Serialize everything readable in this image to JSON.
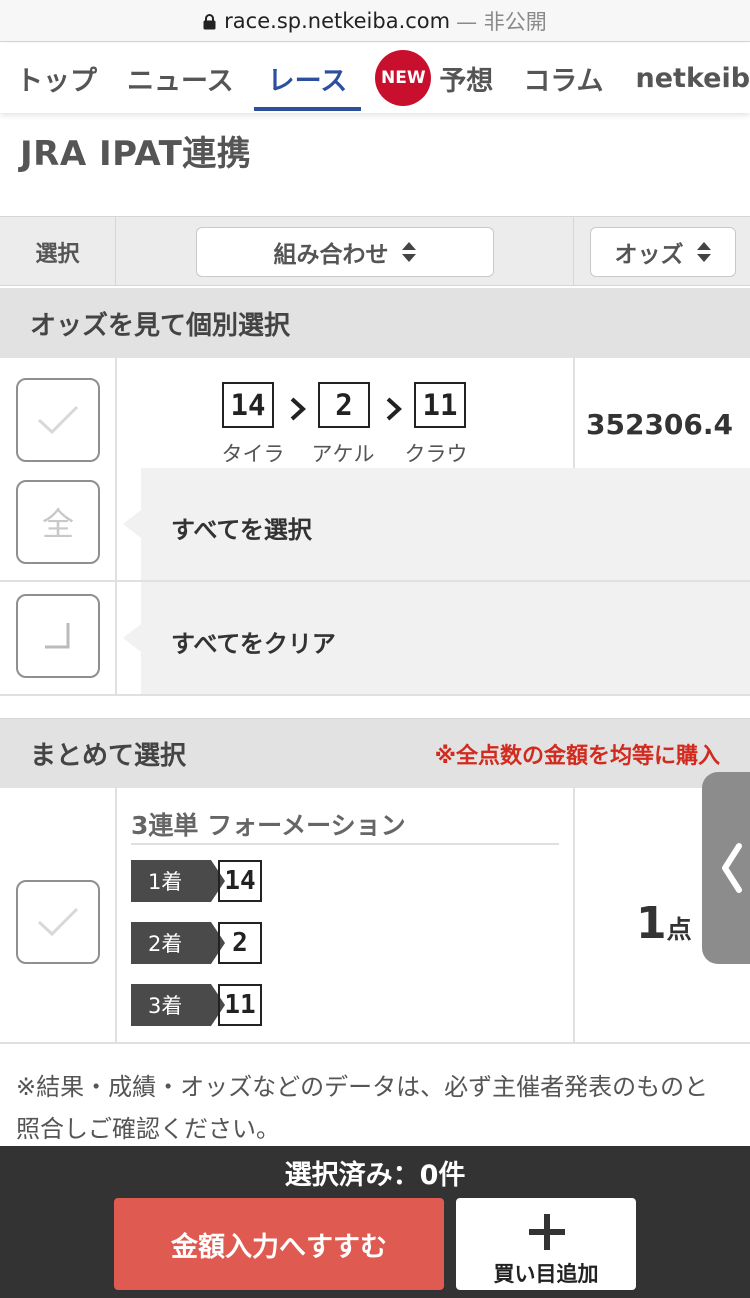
{
  "browser": {
    "url": "race.sp.netkeiba.com",
    "privacy_label": "— 非公開"
  },
  "nav": {
    "items": [
      {
        "label": "トップ"
      },
      {
        "label": "ニュース"
      },
      {
        "label": "レース",
        "active": true
      },
      {
        "label": "予想",
        "badge": "NEW"
      },
      {
        "label": "コラム"
      },
      {
        "label": "netkeiba"
      }
    ]
  },
  "page": {
    "title": "JRA IPAT連携"
  },
  "table_header": {
    "select": "選択",
    "combination": "組み合わせ",
    "odds": "オッズ"
  },
  "individual": {
    "heading": "オッズを見て個別選択",
    "bet": {
      "numbers": [
        "14",
        "2",
        "11"
      ],
      "horses": [
        "タイラ",
        "アケル",
        "クラウ"
      ],
      "odds": "352306.4"
    },
    "select_all": {
      "icon_char": "全",
      "label": "すべてを選択"
    },
    "clear_all": {
      "label": "すべてをクリア"
    }
  },
  "bulk": {
    "heading": "まとめて選択",
    "note": "※全点数の金額を均等に購入",
    "bet_type": "3連単 フォーメーション",
    "places": [
      {
        "tag": "1着",
        "number": "14"
      },
      {
        "tag": "2着",
        "number": "2"
      },
      {
        "tag": "3着",
        "number": "11"
      }
    ],
    "points": "1",
    "points_unit": "点"
  },
  "footnote": "※結果・成績・オッズなどのデータは、必ず主催者発表のものと照合しご確認ください。",
  "bottom": {
    "selected": "選択済み：0件",
    "proceed": "金額入力へすすむ",
    "add": "買い目追加"
  },
  "colors": {
    "accent_blue": "#2c4f9e",
    "badge_red": "#c8102e",
    "note_red": "#d22a1e",
    "proceed_red": "#df5a50",
    "bottom_bar": "#333333"
  }
}
